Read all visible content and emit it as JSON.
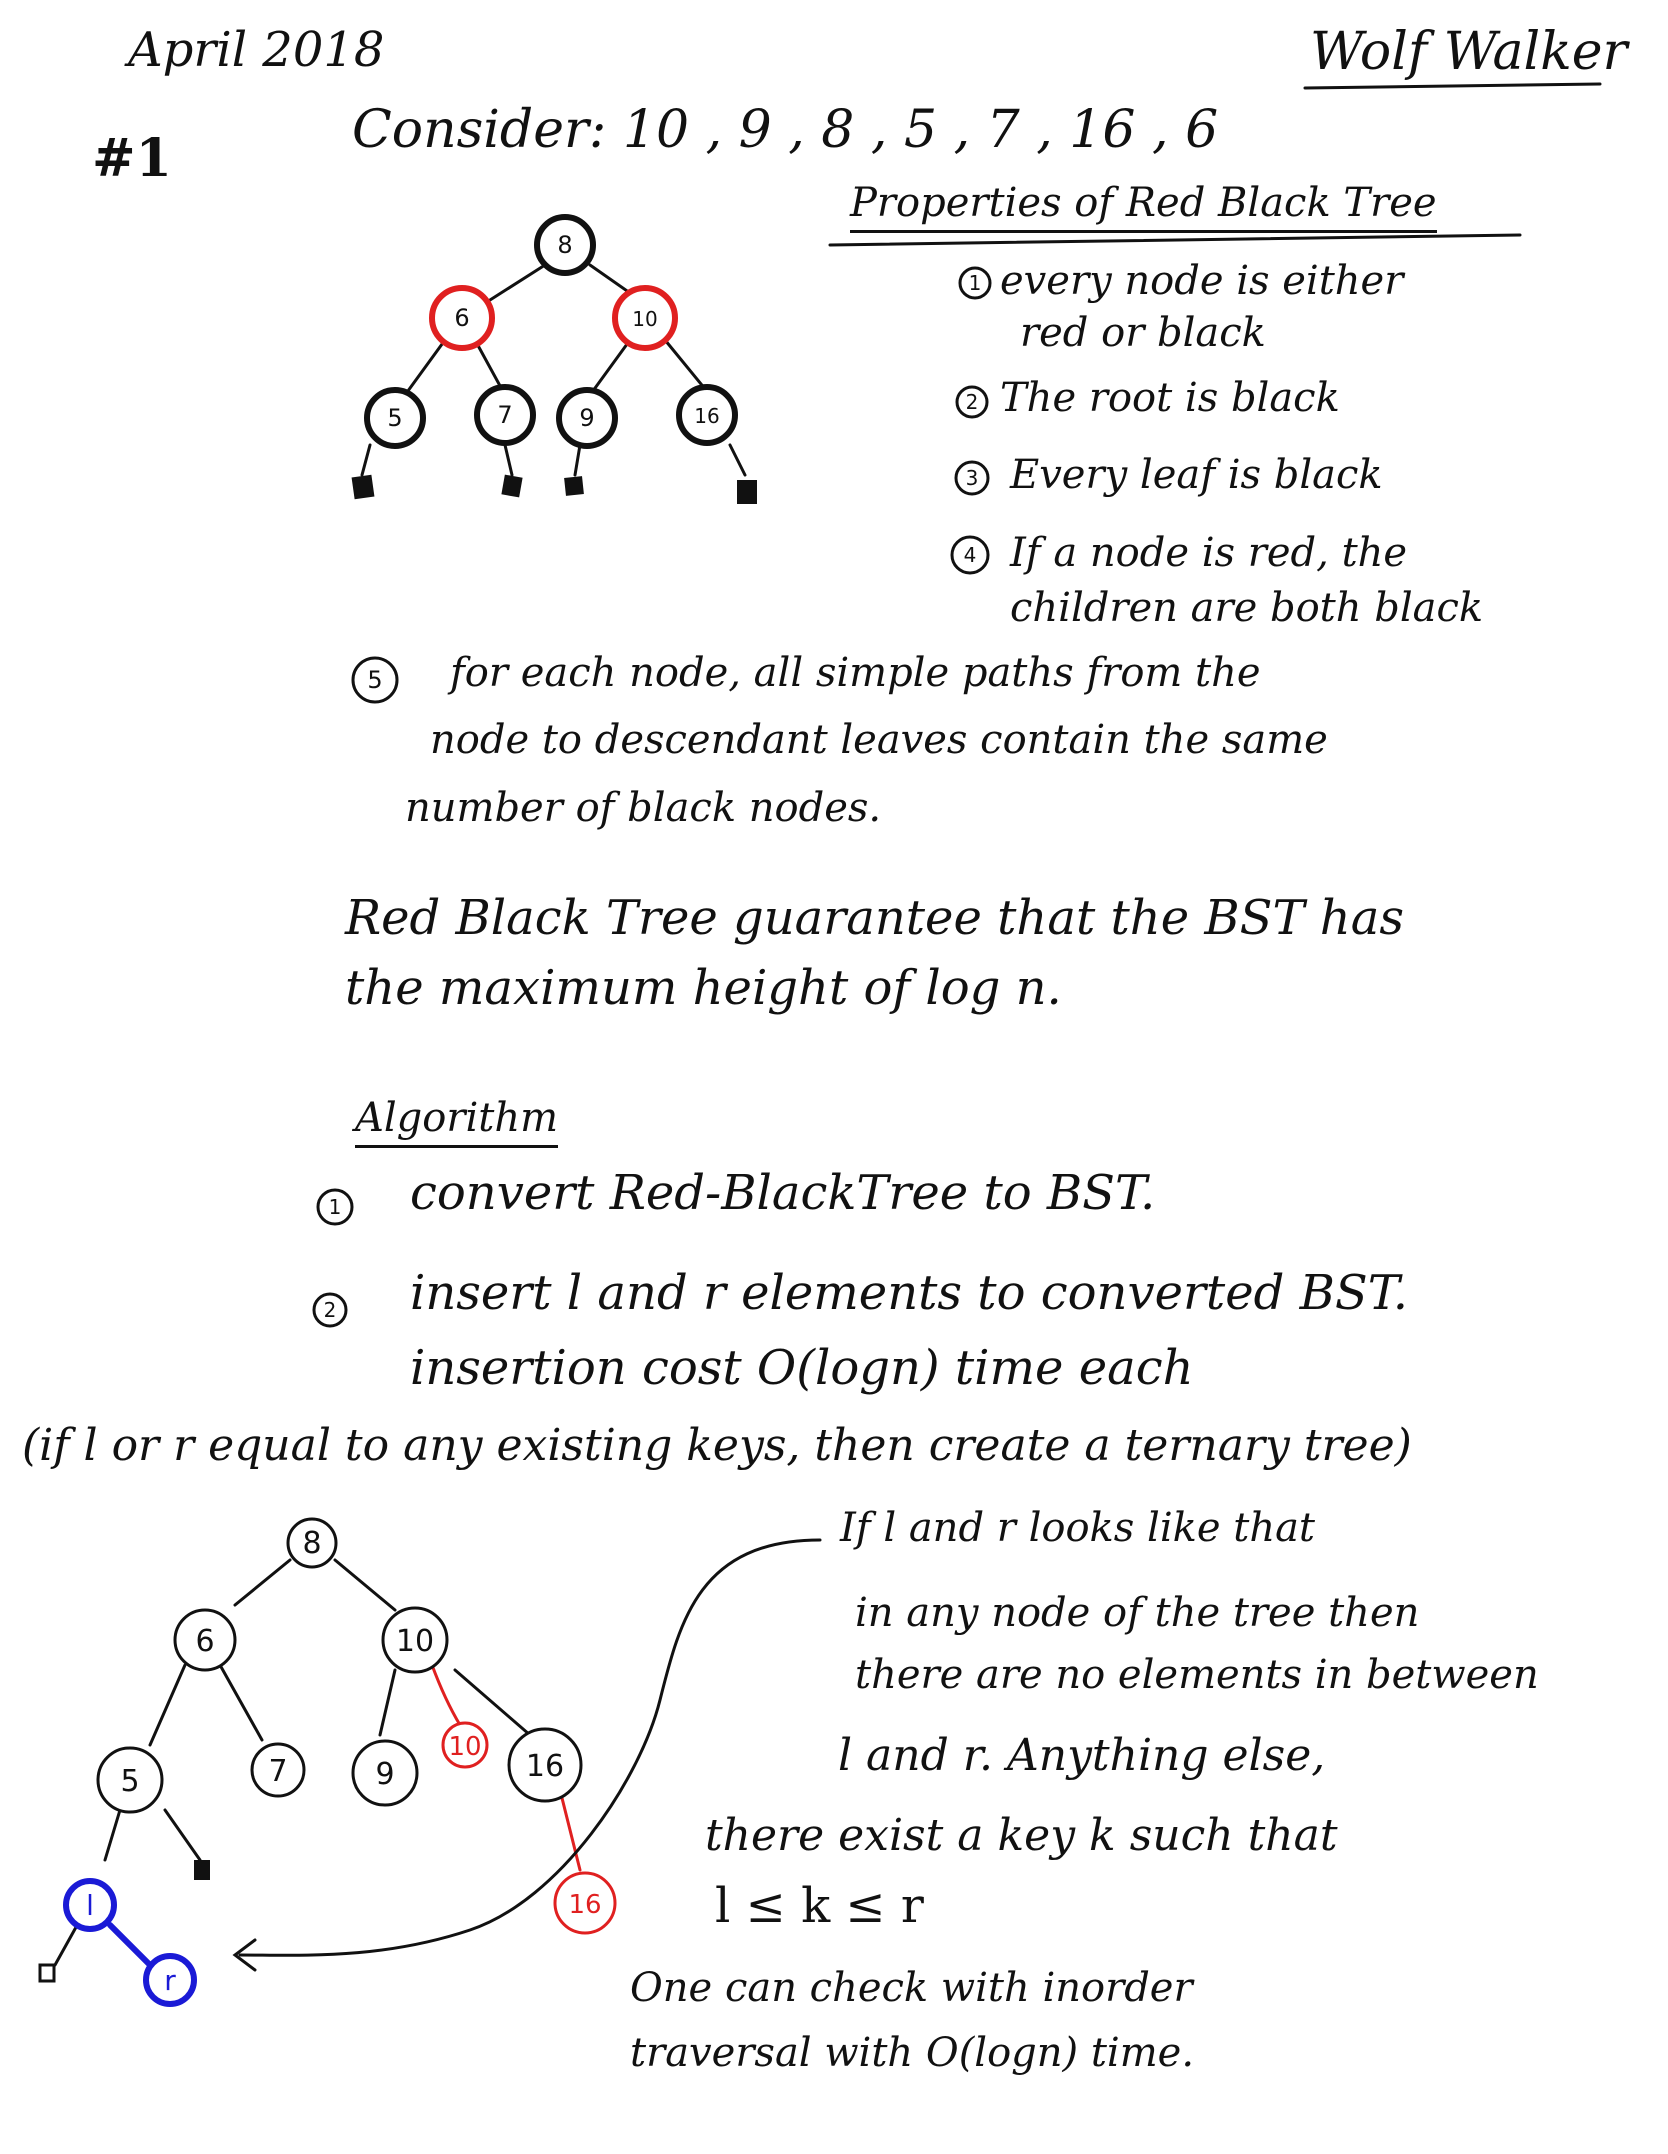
{
  "header": {
    "date": "April 2018",
    "author": "Wolf Walker",
    "problem_number": "#1"
  },
  "intro": {
    "consider": "Consider: 10 , 9 , 8 , 5 , 7 , 16 , 6"
  },
  "properties": {
    "title": "Properties of Red Black Tree",
    "items": [
      {
        "num": "1",
        "text": "every node is either",
        "text2": "red or black"
      },
      {
        "num": "2",
        "text": "The root is black"
      },
      {
        "num": "3",
        "text": "Every leaf is black"
      },
      {
        "num": "4",
        "text": "If a node is red, the",
        "text2": "children are both black"
      },
      {
        "num": "5",
        "text": "for each node, all simple paths from the",
        "text2": "node to descendant leaves contain the same",
        "text3": "number of black nodes."
      }
    ]
  },
  "guarantee": {
    "line1": "Red Black Tree guarantee that the BST has",
    "line2": "the maximum height of log n."
  },
  "algorithm": {
    "title": "Algorithm",
    "steps": [
      {
        "num": "1",
        "text": "convert Red-BlackTree to BST."
      },
      {
        "num": "2",
        "text": "insert l and r elements to converted BST.",
        "text2": "insertion cost O(logn) time each"
      }
    ],
    "note": "(if l or r equal to any existing keys, then create a ternary tree)"
  },
  "tree1": {
    "nodes": [
      {
        "label": "8",
        "color": "black"
      },
      {
        "label": "6",
        "color": "red"
      },
      {
        "label": "10",
        "color": "red"
      },
      {
        "label": "5",
        "color": "black"
      },
      {
        "label": "7",
        "color": "black"
      },
      {
        "label": "9",
        "color": "black"
      },
      {
        "label": "16",
        "color": "black"
      }
    ]
  },
  "tree2": {
    "nodes": [
      {
        "label": "8"
      },
      {
        "label": "6"
      },
      {
        "label": "10"
      },
      {
        "label": "5"
      },
      {
        "label": "7"
      },
      {
        "label": "9"
      },
      {
        "label": "16"
      }
    ],
    "inserted_red": [
      "10",
      "16"
    ],
    "inserted_blue": [
      "l",
      "r"
    ]
  },
  "explanation": {
    "lines": [
      "If l and r looks like that",
      "in any node of the tree then",
      "there are no elements in between",
      "l and r. Anything else,",
      "there exist a key k such that",
      "l ≤ k ≤ r"
    ],
    "footnote1": "One can check with inorder",
    "footnote2": "traversal with O(logn) time."
  },
  "colors": {
    "ink": "#111111",
    "red": "#e02020",
    "blue": "#1a1ad6"
  }
}
